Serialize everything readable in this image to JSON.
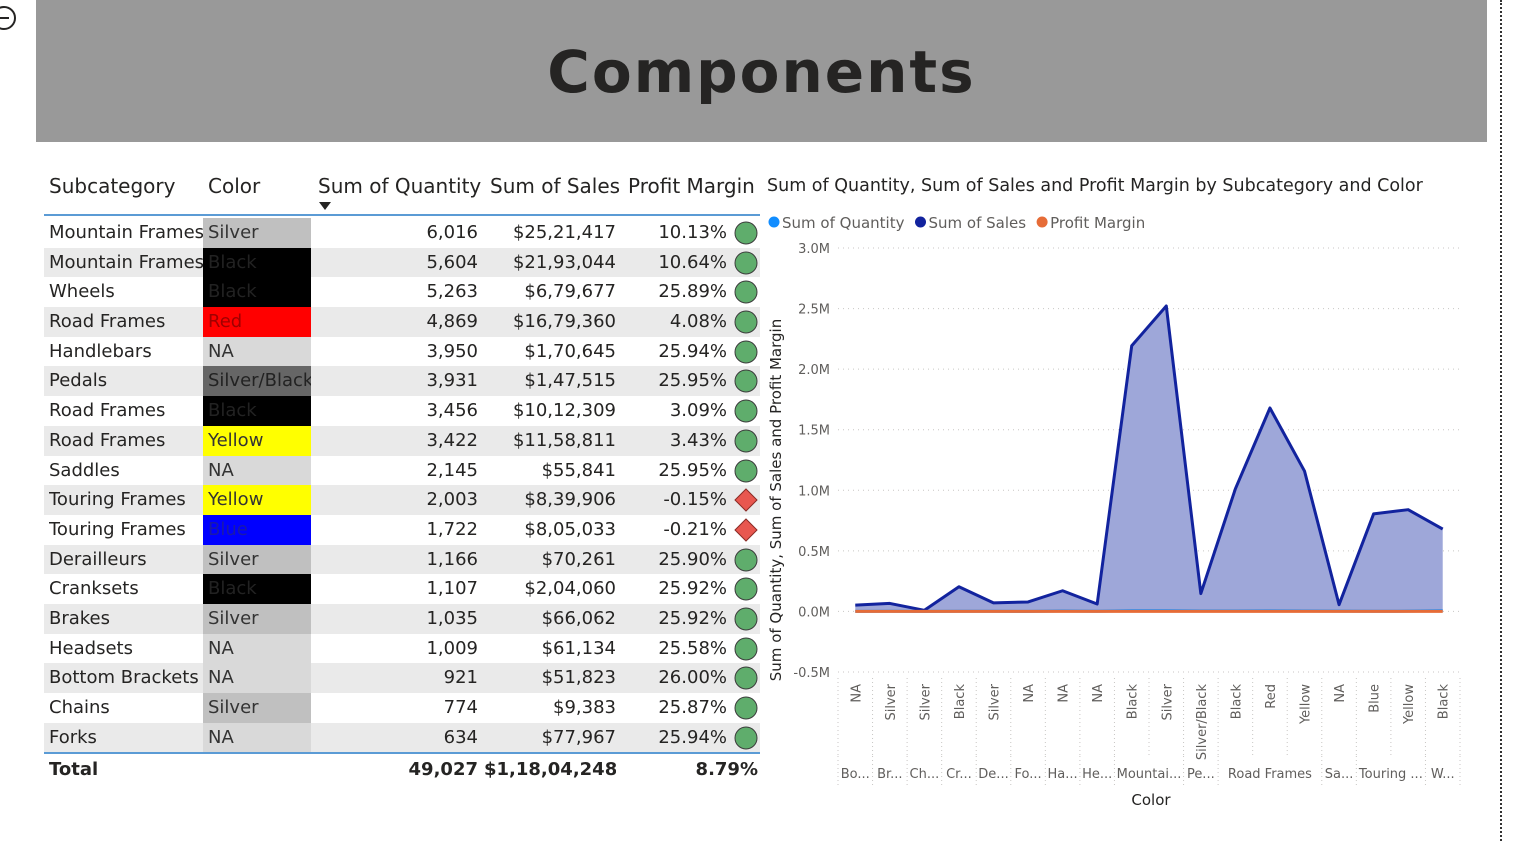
{
  "page": {
    "title": "Components"
  },
  "table": {
    "headers": {
      "subcategory": "Subcategory",
      "color": "Color",
      "quantity": "Sum of Quantity",
      "sales": "Sum of Sales",
      "margin": "Profit Margin"
    },
    "rows": [
      {
        "sub": "Mountain Frames",
        "color": "Silver",
        "swatch": "#c0c0c0",
        "text": "#333333",
        "qty": "6,016",
        "sales": "$25,21,417",
        "pm": "10.13%",
        "status": "good"
      },
      {
        "sub": "Mountain Frames",
        "color": "Black",
        "swatch": "#000000",
        "text": "#222222",
        "qty": "5,604",
        "sales": "$21,93,044",
        "pm": "10.64%",
        "status": "good"
      },
      {
        "sub": "Wheels",
        "color": "Black",
        "swatch": "#000000",
        "text": "#222222",
        "qty": "5,263",
        "sales": "$6,79,677",
        "pm": "25.89%",
        "status": "good"
      },
      {
        "sub": "Road Frames",
        "color": "Red",
        "swatch": "#ff0000",
        "text": "#a00000",
        "qty": "4,869",
        "sales": "$16,79,360",
        "pm": "4.08%",
        "status": "good"
      },
      {
        "sub": "Handlebars",
        "color": "NA",
        "swatch": "#d9d9d9",
        "text": "#333333",
        "qty": "3,950",
        "sales": "$1,70,645",
        "pm": "25.94%",
        "status": "good"
      },
      {
        "sub": "Pedals",
        "color": "Silver/Black",
        "swatch": "#666666",
        "text": "#222222",
        "qty": "3,931",
        "sales": "$1,47,515",
        "pm": "25.95%",
        "status": "good"
      },
      {
        "sub": "Road Frames",
        "color": "Black",
        "swatch": "#000000",
        "text": "#222222",
        "qty": "3,456",
        "sales": "$10,12,309",
        "pm": "3.09%",
        "status": "good"
      },
      {
        "sub": "Road Frames",
        "color": "Yellow",
        "swatch": "#ffff00",
        "text": "#333333",
        "qty": "3,422",
        "sales": "$11,58,811",
        "pm": "3.43%",
        "status": "good"
      },
      {
        "sub": "Saddles",
        "color": "NA",
        "swatch": "#d9d9d9",
        "text": "#333333",
        "qty": "2,145",
        "sales": "$55,841",
        "pm": "25.95%",
        "status": "good"
      },
      {
        "sub": "Touring Frames",
        "color": "Yellow",
        "swatch": "#ffff00",
        "text": "#333333",
        "qty": "2,003",
        "sales": "$8,39,906",
        "pm": "-0.15%",
        "status": "bad"
      },
      {
        "sub": "Touring Frames",
        "color": "Blue",
        "swatch": "#0000ff",
        "text": "#1a1aa8",
        "qty": "1,722",
        "sales": "$8,05,033",
        "pm": "-0.21%",
        "status": "bad"
      },
      {
        "sub": "Derailleurs",
        "color": "Silver",
        "swatch": "#c0c0c0",
        "text": "#333333",
        "qty": "1,166",
        "sales": "$70,261",
        "pm": "25.90%",
        "status": "good"
      },
      {
        "sub": "Cranksets",
        "color": "Black",
        "swatch": "#000000",
        "text": "#222222",
        "qty": "1,107",
        "sales": "$2,04,060",
        "pm": "25.92%",
        "status": "good"
      },
      {
        "sub": "Brakes",
        "color": "Silver",
        "swatch": "#c0c0c0",
        "text": "#333333",
        "qty": "1,035",
        "sales": "$66,062",
        "pm": "25.92%",
        "status": "good"
      },
      {
        "sub": "Headsets",
        "color": "NA",
        "swatch": "#d9d9d9",
        "text": "#333333",
        "qty": "1,009",
        "sales": "$61,134",
        "pm": "25.58%",
        "status": "good"
      },
      {
        "sub": "Bottom Brackets",
        "color": "NA",
        "swatch": "#d9d9d9",
        "text": "#333333",
        "qty": "921",
        "sales": "$51,823",
        "pm": "26.00%",
        "status": "good"
      },
      {
        "sub": "Chains",
        "color": "Silver",
        "swatch": "#c0c0c0",
        "text": "#333333",
        "qty": "774",
        "sales": "$9,383",
        "pm": "25.87%",
        "status": "good"
      },
      {
        "sub": "Forks",
        "color": "NA",
        "swatch": "#d9d9d9",
        "text": "#333333",
        "qty": "634",
        "sales": "$77,967",
        "pm": "25.94%",
        "status": "good"
      }
    ],
    "total": {
      "label": "Total",
      "qty": "49,027",
      "sales": "$1,18,04,248",
      "pm": "8.79%"
    },
    "status_colors": {
      "good": "#5fad6c",
      "bad": "#e8574f"
    }
  },
  "chart_data": {
    "type": "area",
    "title": "Sum of Quantity, Sum of Sales and Profit Margin by Subcategory and Color",
    "xlabel": "Color",
    "ylabel": "Sum of Quantity, Sum of Sales and Profit Margin",
    "ylim": [
      -500000,
      3000000
    ],
    "yticks": [
      {
        "v": 3000000,
        "label": "3.0M"
      },
      {
        "v": 2500000,
        "label": "2.5M"
      },
      {
        "v": 2000000,
        "label": "2.0M"
      },
      {
        "v": 1500000,
        "label": "1.5M"
      },
      {
        "v": 1000000,
        "label": "1.0M"
      },
      {
        "v": 500000,
        "label": "0.5M"
      },
      {
        "v": 0,
        "label": "0.0M"
      },
      {
        "v": -500000,
        "label": "-0.5M"
      }
    ],
    "legend_position": "top-left",
    "grid": true,
    "categories": [
      "NA",
      "Silver",
      "Silver",
      "Black",
      "Silver",
      "NA",
      "NA",
      "NA",
      "Black",
      "Silver",
      "Silver/Black",
      "Black",
      "Red",
      "Yellow",
      "NA",
      "Blue",
      "Yellow",
      "Black"
    ],
    "groups": [
      {
        "label": "Bo...",
        "count": 1
      },
      {
        "label": "Br...",
        "count": 1
      },
      {
        "label": "Ch...",
        "count": 1
      },
      {
        "label": "Cr...",
        "count": 1
      },
      {
        "label": "De...",
        "count": 1
      },
      {
        "label": "Fo...",
        "count": 1
      },
      {
        "label": "Ha...",
        "count": 1
      },
      {
        "label": "He...",
        "count": 1
      },
      {
        "label": "Mountai...",
        "count": 2
      },
      {
        "label": "Pe...",
        "count": 1
      },
      {
        "label": "Road Frames",
        "count": 3
      },
      {
        "label": "Sa...",
        "count": 1
      },
      {
        "label": "Touring ...",
        "count": 2
      },
      {
        "label": "W...",
        "count": 1
      }
    ],
    "series": [
      {
        "name": "Sum of Quantity",
        "color": "#118dff",
        "values": [
          921,
          1035,
          774,
          1107,
          1166,
          634,
          3950,
          1009,
          5604,
          6016,
          3931,
          3456,
          4869,
          3422,
          2145,
          1722,
          2003,
          5263
        ]
      },
      {
        "name": "Sum of Sales",
        "color": "#12239e",
        "fill": "#9ea7d9",
        "values": [
          51823,
          66062,
          9383,
          204060,
          70261,
          77967,
          170645,
          61134,
          2193044,
          2521417,
          147515,
          1012309,
          1679360,
          1158811,
          55841,
          805033,
          839906,
          679677
        ]
      },
      {
        "name": "Profit Margin",
        "color": "#e66c37",
        "values": [
          0.26,
          0.2592,
          0.2587,
          0.2592,
          0.259,
          0.2594,
          0.2594,
          0.2558,
          0.1064,
          0.1013,
          0.2595,
          0.0309,
          0.0408,
          0.0343,
          0.2595,
          -0.0021,
          -0.0015,
          0.2589
        ]
      }
    ]
  }
}
